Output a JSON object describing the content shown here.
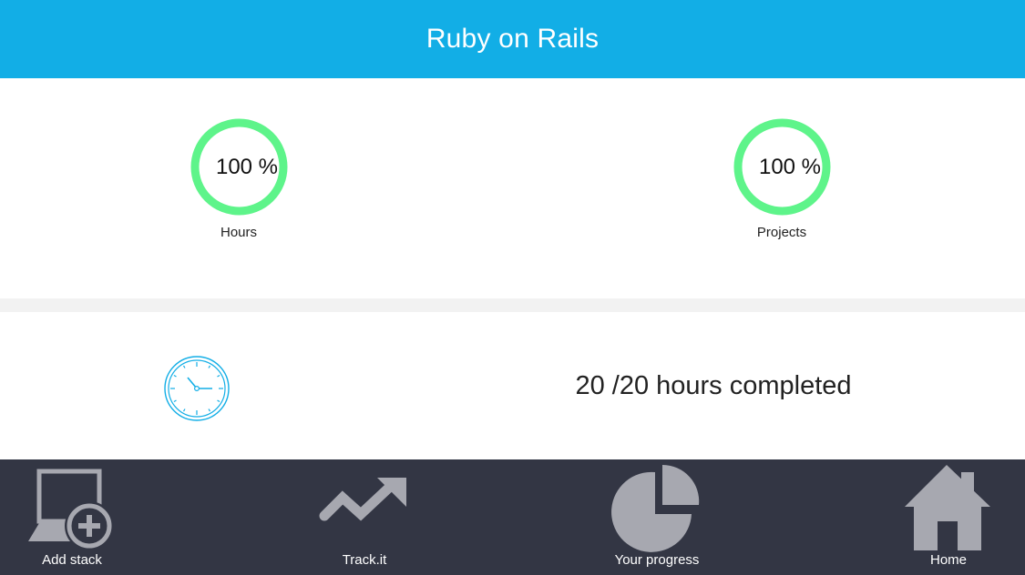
{
  "header": {
    "title": "Ruby on Rails",
    "bg_color": "#12aee6"
  },
  "stats": [
    {
      "label": "Hours",
      "percent_text": "100 %",
      "percent": 100,
      "ring_color": "#5ef48a"
    },
    {
      "label": "Projects",
      "percent_text": "100 %",
      "percent": 100,
      "ring_color": "#5ef48a"
    }
  ],
  "summary": {
    "icon": "clock-icon",
    "text": "20 /20 hours completed",
    "accent": "#12aee6"
  },
  "nav": {
    "bg_color": "#333644",
    "icon_color": "#a7a8b0",
    "items": [
      {
        "label": "Add stack",
        "icon": "add-stack-icon"
      },
      {
        "label": "Track.it",
        "icon": "trending-up-icon"
      },
      {
        "label": "Your progress",
        "icon": "pie-chart-icon"
      },
      {
        "label": "Home",
        "icon": "home-icon"
      }
    ]
  }
}
